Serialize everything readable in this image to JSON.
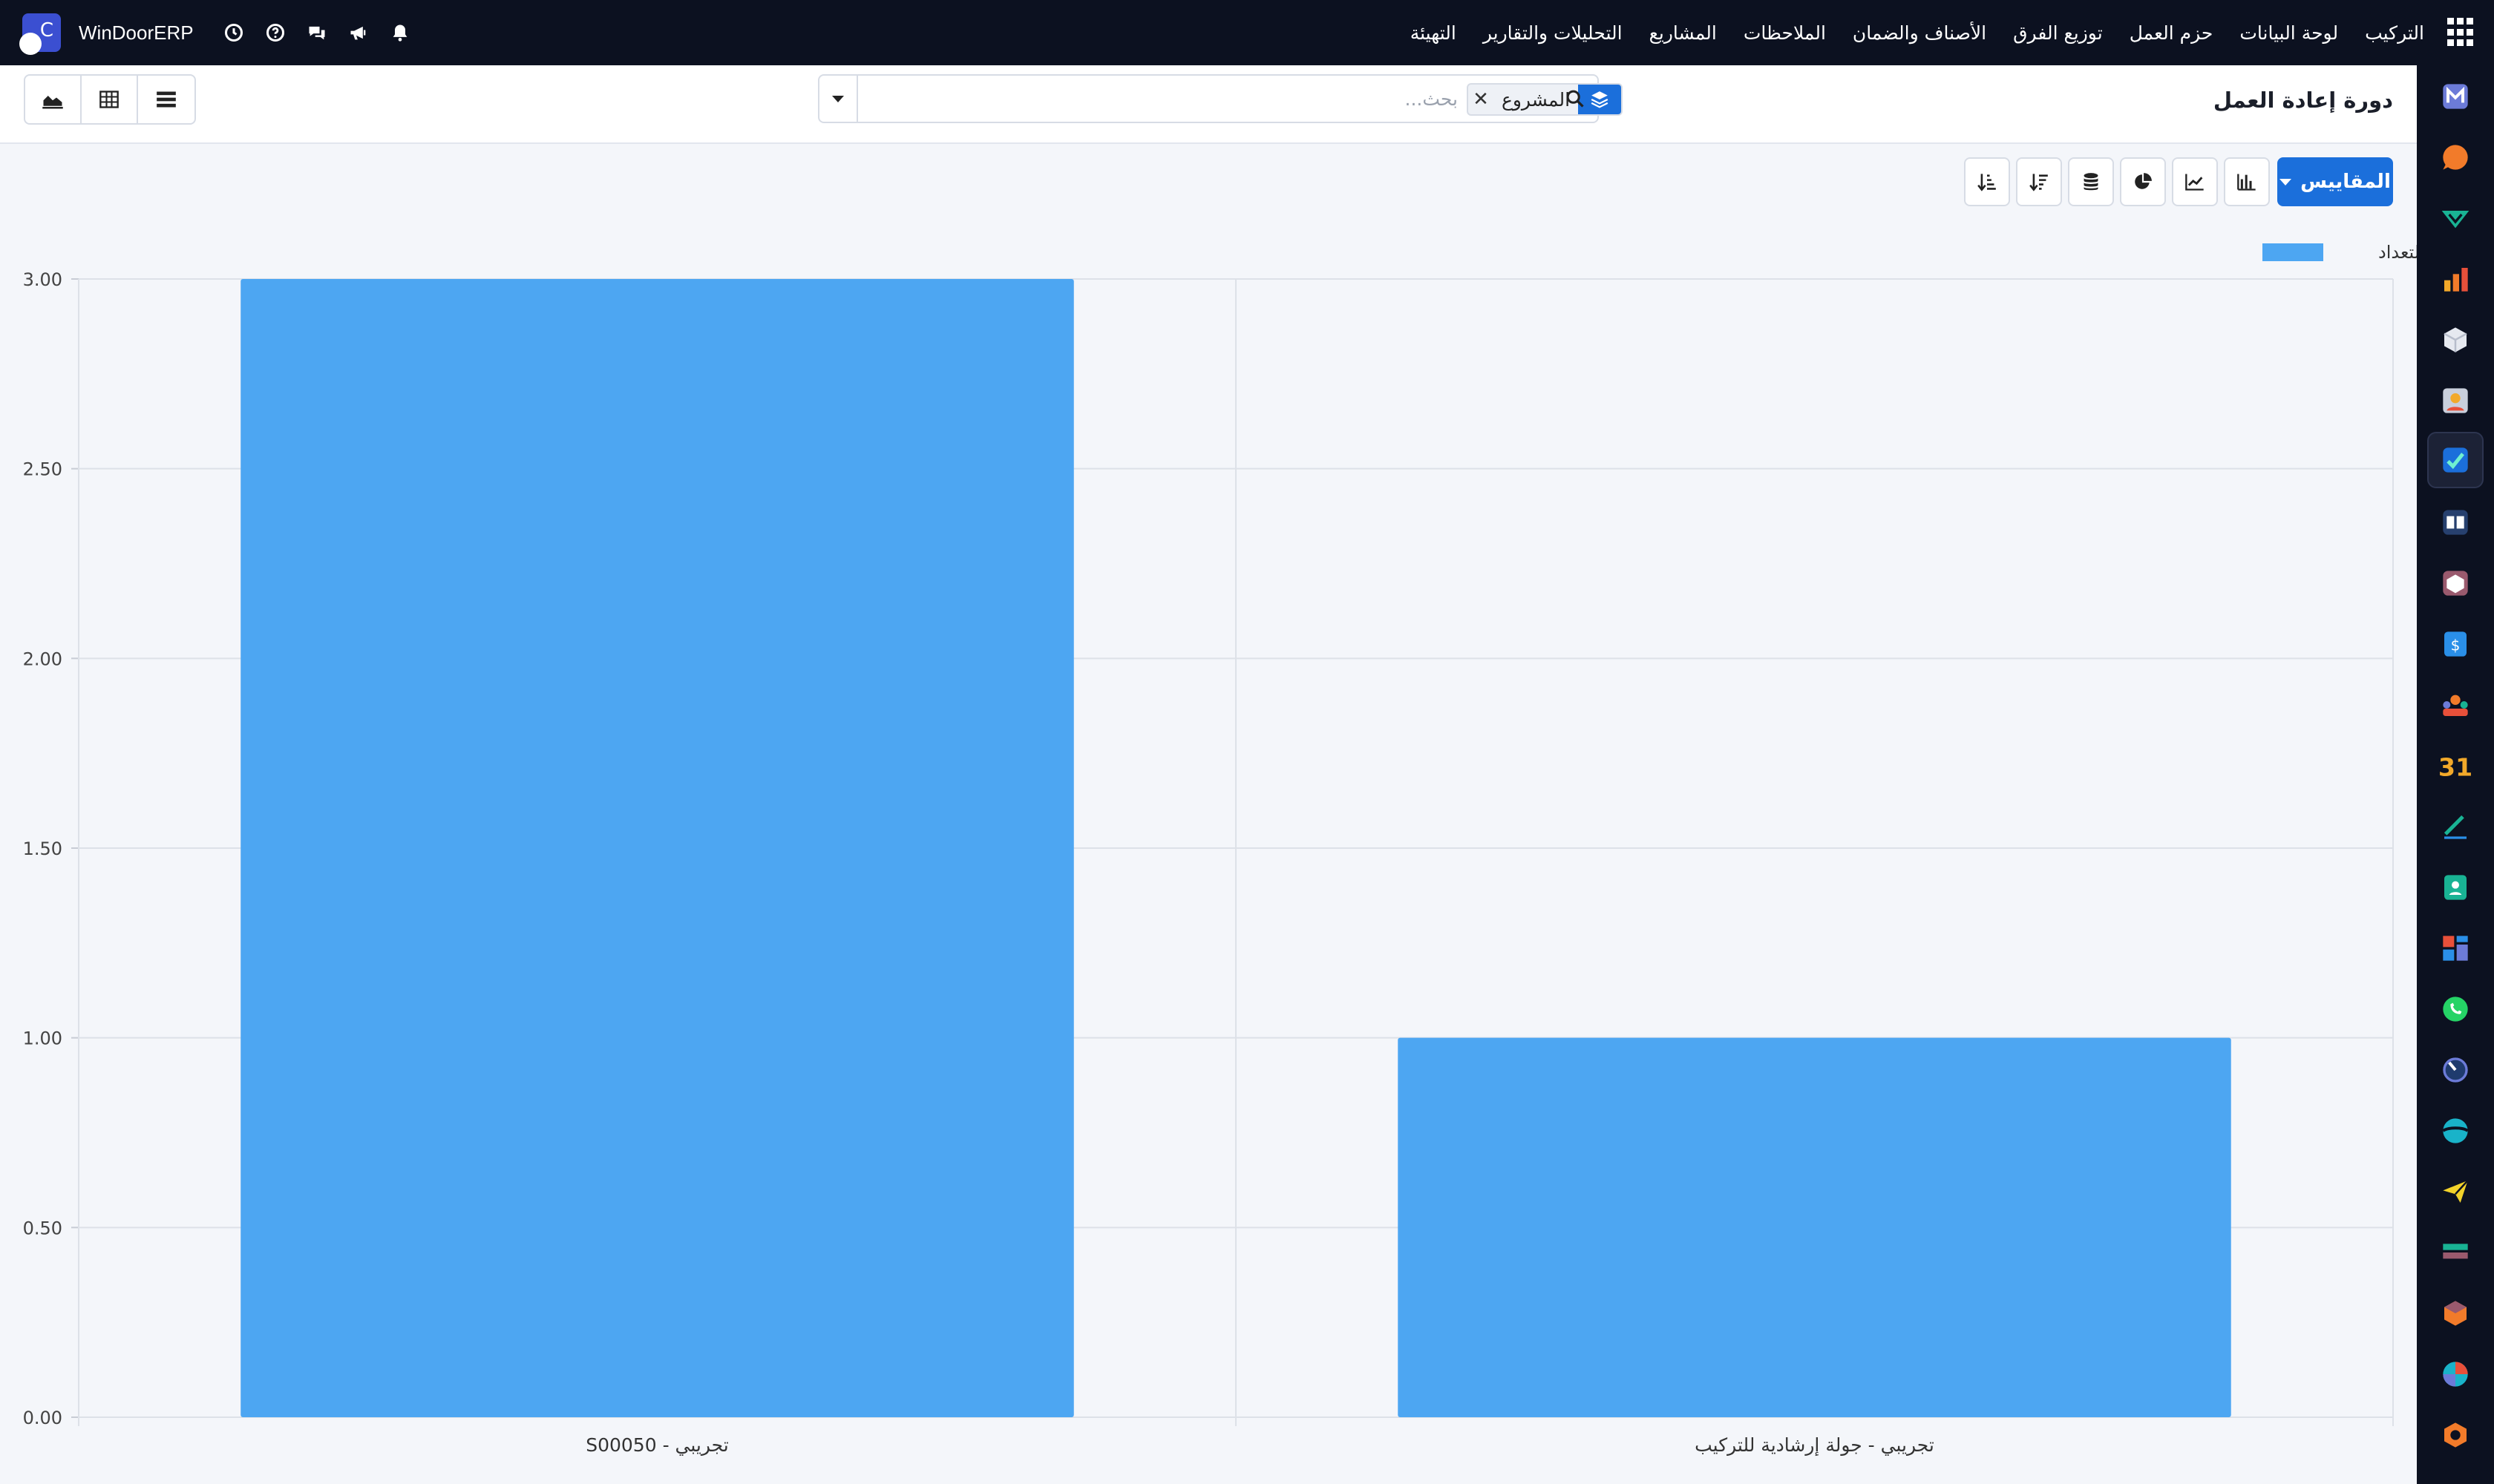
{
  "topbar": {
    "brand": "WinDoorERP",
    "menu": [
      "التركيب",
      "لوحة البيانات",
      "حزم العمل",
      "توزيع الفرق",
      "الأصناف والضمان",
      "الملاحظات",
      "المشاريع",
      "التحليلات والتقارير",
      "التهيئة"
    ]
  },
  "control_panel": {
    "title": "دورة إعادة العمل",
    "search_placeholder": "بحث...",
    "facet_label": "المشروع"
  },
  "toolbar": {
    "measures_label": "المقاييس"
  },
  "colors": {
    "accent": "#1b6fdb",
    "bar": "#4da6f2",
    "nav_bg": "#0c1120"
  },
  "chart_data": {
    "type": "bar",
    "categories": [
      "تجريبي - S00050",
      "تجريبي - جولة إرشادية للتركيب"
    ],
    "series": [
      {
        "name": "التعداد",
        "values": [
          3,
          1
        ]
      }
    ],
    "ylim": [
      0,
      3
    ],
    "yticks": [
      "0.00",
      "0.50",
      "1.00",
      "1.50",
      "2.00",
      "2.50",
      "3.00"
    ],
    "legend": "top-right",
    "grid": true
  }
}
